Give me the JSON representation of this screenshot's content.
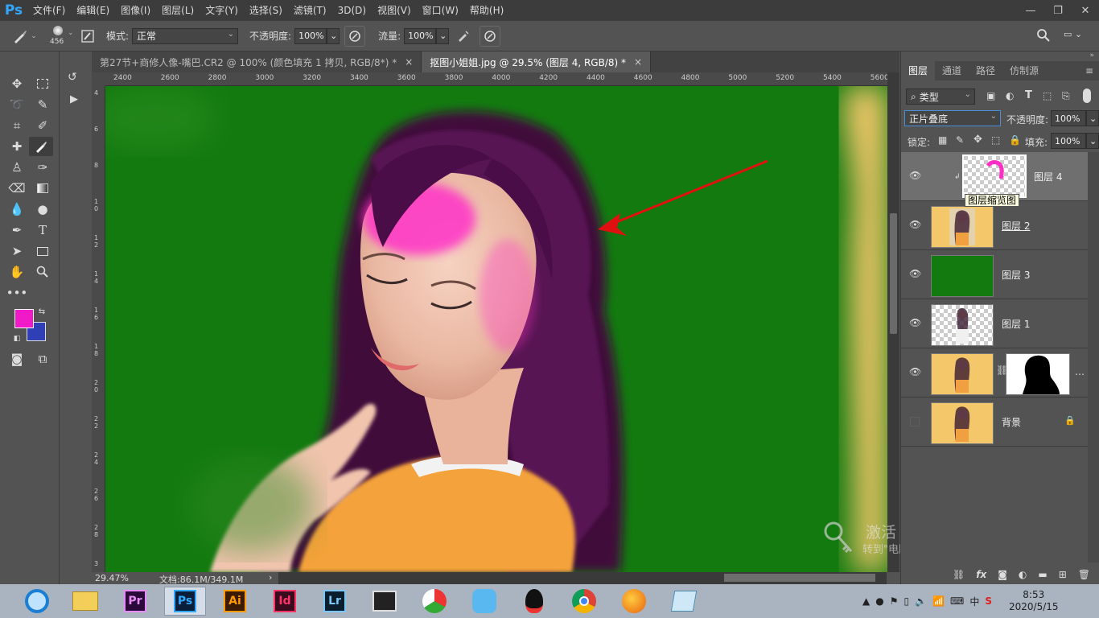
{
  "app": {
    "logo": "Ps",
    "menus": [
      "文件(F)",
      "编辑(E)",
      "图像(I)",
      "图层(L)",
      "文字(Y)",
      "选择(S)",
      "滤镜(T)",
      "3D(D)",
      "视图(V)",
      "窗口(W)",
      "帮助(H)"
    ],
    "window_controls": [
      "minimize-icon",
      "restore-icon",
      "close-icon"
    ]
  },
  "options": {
    "brush_size": "456",
    "mode_label": "模式:",
    "mode_value": "正常",
    "opacity_label": "不透明度:",
    "opacity_value": "100%",
    "flow_label": "流量:",
    "flow_value": "100%"
  },
  "tabs": [
    {
      "label": "第27节+商修人像-嘴巴.CR2 @ 100% (颜色填充 1 拷贝, RGB/8*) *",
      "close": "×",
      "active": false
    },
    {
      "label": "抠图小姐姐.jpg @ 29.5% (图层 4, RGB/8) *",
      "close": "×",
      "active": true
    }
  ],
  "ruler": {
    "h_labels": [
      "2400",
      "2600",
      "2800",
      "3000",
      "3200",
      "3400",
      "3600",
      "3800",
      "4000",
      "4200",
      "4400",
      "4600",
      "4800",
      "5000",
      "5200",
      "5400",
      "5600"
    ],
    "v_labels": [
      "4",
      "6",
      "8",
      "1 0",
      "1 2",
      "1 4",
      "1 6",
      "1 8",
      "2 0",
      "2 2",
      "2 4",
      "2 6",
      "2 8",
      "3"
    ]
  },
  "status": {
    "zoom": "29.47%",
    "doc_info": "文档:86.1M/349.1M"
  },
  "watermark": {
    "line1": "激活 Windows",
    "line2": "转到\"电脑设置\"以激活 Windows。"
  },
  "layers_panel": {
    "tabs": [
      "图层",
      "通道",
      "路径",
      "仿制源"
    ],
    "filter_label": "类型",
    "blend_mode": "正片叠底",
    "opacity_label": "不透明度:",
    "opacity_value": "100%",
    "lock_label": "锁定:",
    "fill_label": "填充:",
    "fill_value": "100%",
    "tooltip": "图层缩览图",
    "layers": [
      {
        "name": "图层 4",
        "visible": true,
        "selected": true
      },
      {
        "name": "图层 2",
        "visible": true,
        "selected": false
      },
      {
        "name": "图层 3",
        "visible": true,
        "selected": false
      },
      {
        "name": "图层 1",
        "visible": true,
        "selected": false
      },
      {
        "name": "",
        "visible": true,
        "selected": false
      },
      {
        "name": "背景",
        "visible": false,
        "selected": false
      }
    ],
    "footer_icons": [
      "link-icon",
      "fx-icon",
      "mask-icon",
      "adjustment-icon",
      "folder-icon",
      "new-layer-icon",
      "trash-icon"
    ]
  },
  "colors": {
    "foreground": "#f01ac8",
    "background": "#2f3fb5",
    "canvas_green": "#137a10",
    "accent_red": "#e01010"
  },
  "taskbar": {
    "apps": [
      "ie-icon",
      "explorer-icon",
      "premiere-icon",
      "photoshop-icon",
      "illustrator-icon",
      "indesign-icon",
      "lightroom-icon",
      "video-icon",
      "browser-icon",
      "chat-icon",
      "qq-icon",
      "chrome-icon",
      "firefox-icon",
      "notes-icon"
    ],
    "adobe_labels": {
      "pr": "Pr",
      "ps": "Ps",
      "ai": "Ai",
      "id": "Id",
      "lr": "Lr"
    },
    "tray_ime": "中",
    "time": "8:53",
    "date": "2020/5/15"
  }
}
